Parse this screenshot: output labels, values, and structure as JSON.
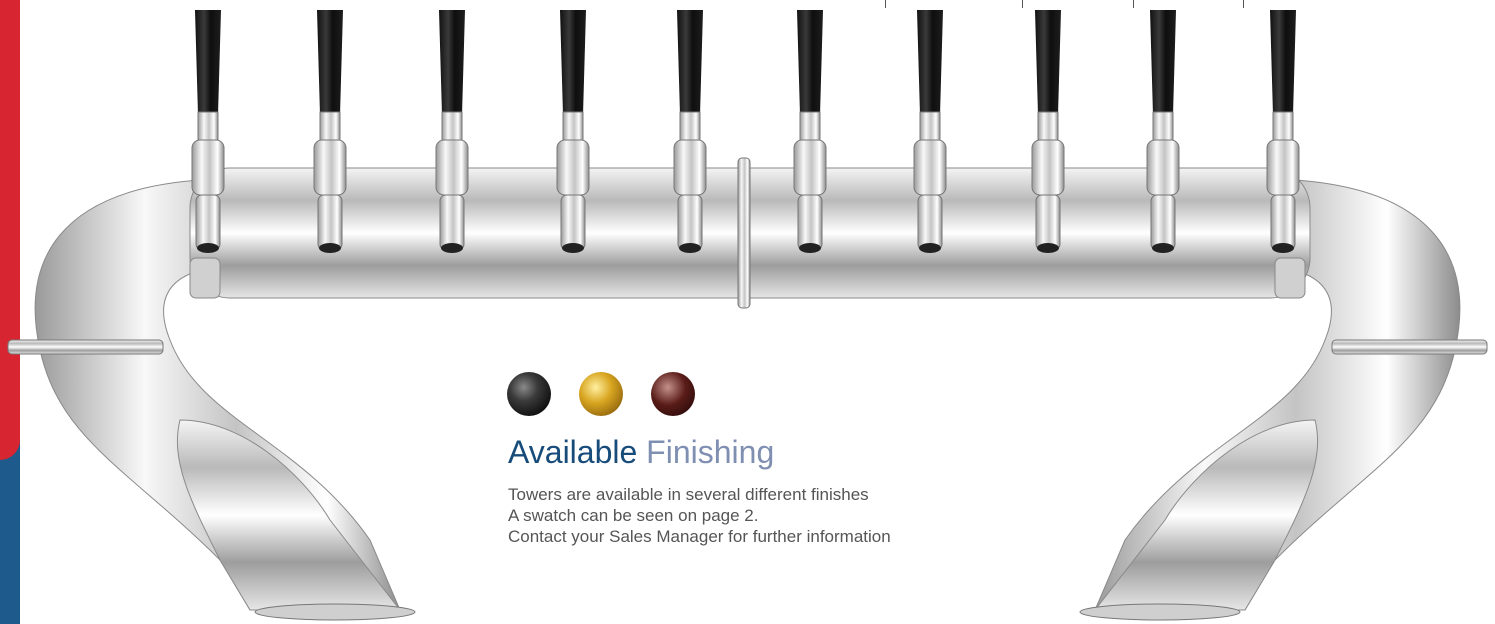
{
  "heading": {
    "primary": "Available",
    "secondary": "Finishing"
  },
  "description": {
    "lines": [
      "Towers are available in several different finishes",
      "A swatch can be seen on page 2.",
      "Contact your Sales Manager for further information"
    ]
  },
  "swatches": [
    {
      "name": "black-finish-swatch",
      "color": "#2a2a2a"
    },
    {
      "name": "gold-finish-swatch",
      "color": "#d2a21e"
    },
    {
      "name": "copper-finish-swatch",
      "color": "#4a1a17"
    }
  ],
  "product_image": {
    "icon": "beer-tower-icon",
    "tap_count": 10
  },
  "colors": {
    "brand_red": "#d72631",
    "brand_blue": "#1f5a8c",
    "heading_dark": "#164b7a",
    "heading_light": "#7f8fb2"
  }
}
